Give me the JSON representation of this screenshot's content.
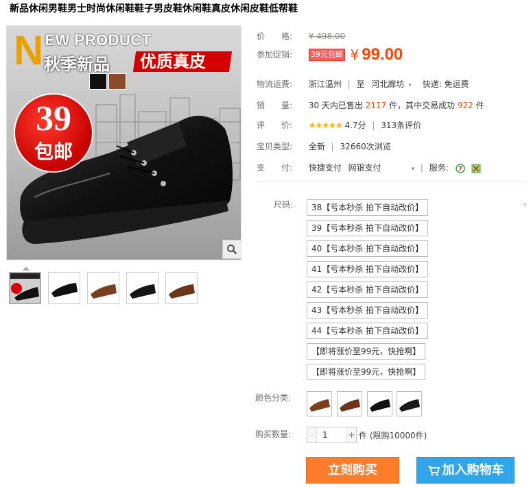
{
  "product": {
    "title": "新品休闲男鞋男士时尚休闲鞋鞋子男皮鞋休闲鞋真皮休闲皮鞋低帮鞋"
  },
  "main_image": {
    "new_product_n": "N",
    "new_product_text": "EW PRODUCT",
    "season_text": "秋季新品",
    "leather_text": "优质真皮",
    "badge_number": "39",
    "badge_text": "包邮"
  },
  "price": {
    "label": "价　　格:",
    "original": "¥ 498.00"
  },
  "promo": {
    "label": "参加促销:",
    "tag": "39元包邮",
    "currency": "¥",
    "price": "99.00"
  },
  "shipping": {
    "label": "物流运费:",
    "from": "浙江温州",
    "to_word": "至",
    "to": "河北廊坊",
    "express": "快递: 免运费"
  },
  "sales": {
    "label": "销　　量:",
    "prefix": "30 天内已售出",
    "sold": "2117",
    "mid": "件，其中交易成功",
    "success": "922",
    "suffix": "件"
  },
  "rating": {
    "label": "评　　价:",
    "stars": "★★★★★",
    "score": "4.7分",
    "reviews": "313条评价"
  },
  "item_type": {
    "label": "宝贝类型:",
    "condition": "全新",
    "views": "32660次浏览"
  },
  "payment": {
    "label": "支　　付:",
    "methods": [
      "快捷支付",
      "网银支付"
    ],
    "service_label": "服务:"
  },
  "sku": {
    "label": "尺码:",
    "options": [
      "38【亏本秒杀 拍下自动改价】",
      "39【亏本秒杀 拍下自动改价】",
      "40【亏本秒杀 拍下自动改价】",
      "41【亏本秒杀 拍下自动改价】",
      "42【亏本秒杀 拍下自动改价】",
      "43【亏本秒杀 拍下自动改价】",
      "44【亏本秒杀 拍下自动改价】",
      "【即将涨价至99元，快抢啊】",
      "【即将涨价至99元，快抢啊】"
    ]
  },
  "color": {
    "label": "颜色分类:"
  },
  "quantity": {
    "label": "购买数量:",
    "value": "1",
    "minus": "-",
    "plus": "+",
    "unit_text": "件 (限购10000件)"
  },
  "buttons": {
    "buy_now": "立刻购买",
    "add_to_cart": "加入购物车"
  },
  "colors_accent": {
    "price_orange": "#ff4400",
    "buy_button": "#ff7c2a",
    "cart_button": "#31a5ea"
  }
}
